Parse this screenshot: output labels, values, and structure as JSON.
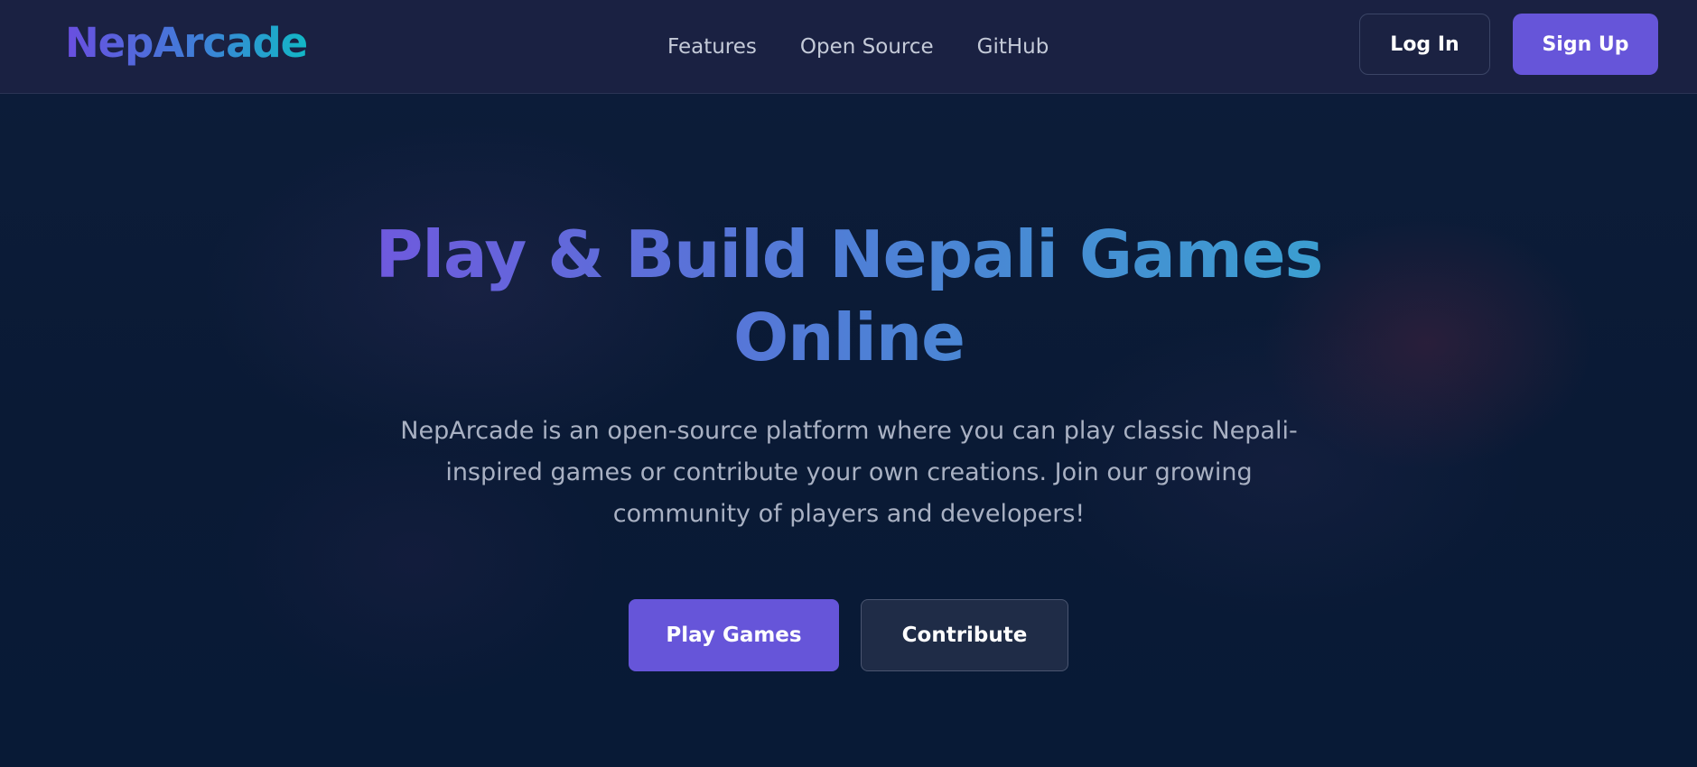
{
  "header": {
    "logo": "NepArcade",
    "nav": [
      {
        "label": "Features"
      },
      {
        "label": "Open Source"
      },
      {
        "label": "GitHub"
      }
    ],
    "login_label": "Log In",
    "signup_label": "Sign Up"
  },
  "hero": {
    "title": "Play & Build Nepali Games Online",
    "description": "NepArcade is an open-source platform where you can play classic Nepali-inspired games or contribute your own creations. Join our growing community of players and developers!",
    "play_label": "Play Games",
    "contribute_label": "Contribute"
  },
  "colors": {
    "accent": "#6655d9",
    "header_bg": "#1a2142",
    "page_bg": "#0b1a33",
    "logo_gradient_start": "#6a4ee0",
    "logo_gradient_end": "#12b8c6"
  }
}
